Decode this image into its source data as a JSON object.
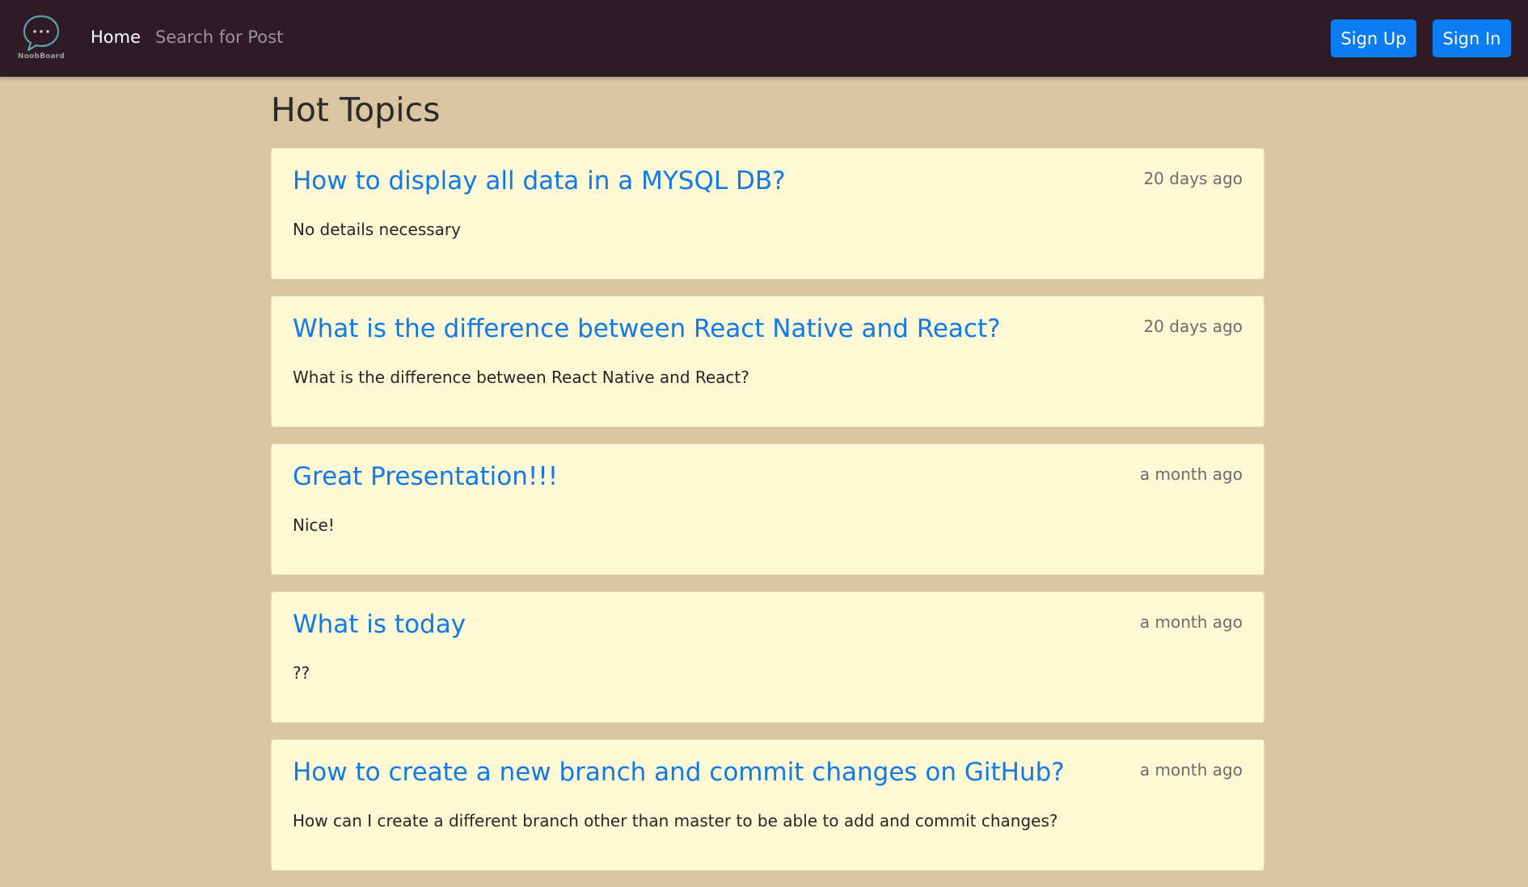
{
  "navbar": {
    "brand_name": "NoobBoard",
    "home_label": "Home",
    "search_label": "Search for Post",
    "signup_label": "Sign Up",
    "signin_label": "Sign In",
    "accent_color": "#0b7cf2",
    "background_color": "#2f1b26"
  },
  "main": {
    "title": "Hot Topics",
    "posts": [
      {
        "title": "How to display all data in a MYSQL DB?",
        "time": "20 days ago",
        "body": "No details necessary"
      },
      {
        "title": "What is the difference between React Native and React?",
        "time": "20 days ago",
        "body": "What is the difference between React Native and React?"
      },
      {
        "title": "Great Presentation!!!",
        "time": "a month ago",
        "body": "Nice!"
      },
      {
        "title": "What is today",
        "time": "a month ago",
        "body": "??"
      },
      {
        "title": "How to create a new branch and commit changes on GitHub?",
        "time": "a month ago",
        "body": "How can I create a different branch other than master to be able to add and commit changes?"
      }
    ]
  }
}
